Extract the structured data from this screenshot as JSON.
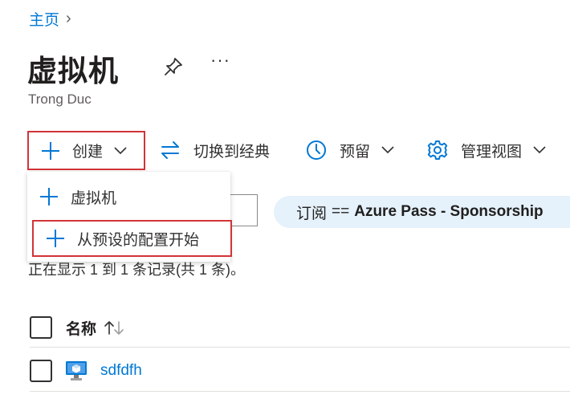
{
  "breadcrumb": {
    "home": "主页",
    "separator": "›"
  },
  "header": {
    "title": "虚拟机",
    "subtitle": "Trong Duc",
    "more": "···"
  },
  "toolbar": {
    "create": "创建",
    "switch_classic": "切换到经典",
    "reserve": "预留",
    "manage_view": "管理视图"
  },
  "create_menu": {
    "items": [
      "虚拟机",
      "从预设的配置开始"
    ]
  },
  "filter": {
    "field": "订阅",
    "operator": "==",
    "value": "Azure Pass - Sponsorship"
  },
  "list": {
    "record_count": "正在显示 1 到 1 条记录(共 1 条)。",
    "columns": {
      "name": "名称"
    },
    "rows": [
      {
        "name": "sdfdfh"
      }
    ]
  },
  "colors": {
    "accent": "#0078d4",
    "highlight_border": "#d13438",
    "pill_bg": "#e5f1fb"
  }
}
